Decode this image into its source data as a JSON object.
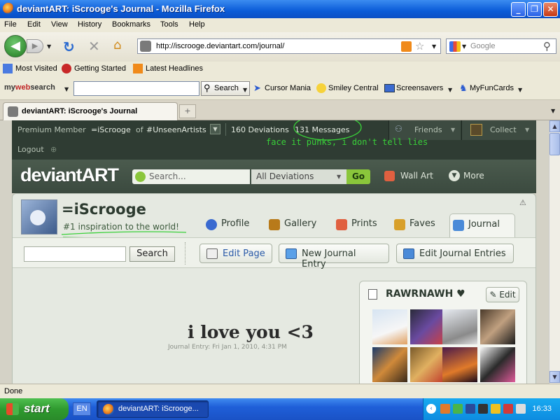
{
  "window": {
    "title": "deviantART: iScrooge's Journal - Mozilla Firefox",
    "buttons": [
      "_",
      "❐",
      "✕"
    ]
  },
  "menu": [
    "File",
    "Edit",
    "View",
    "History",
    "Bookmarks",
    "Tools",
    "Help"
  ],
  "nav": {
    "url": "http://iscrooge.deviantart.com/journal/",
    "search_placeholder": "Google"
  },
  "bookmarks": [
    "Most Visited",
    "Getting Started",
    "Latest Headlines"
  ],
  "mywebsearch": {
    "brand_prefix": "my",
    "brand_mid": "web",
    "brand_suffix": "search",
    "search_button": "Search",
    "items": [
      "Cursor Mania",
      "Smiley Central",
      "Screensavers",
      "MyFunCards"
    ]
  },
  "tab": {
    "label": "deviantART: iScrooge's Journal"
  },
  "da_top": {
    "member_label": "Premium Member",
    "member_name": "=iScrooge",
    "of": "of",
    "group": "#UnseenArtists",
    "deviations": "160 Deviations",
    "messages": "131 Messages",
    "friends": "Friends",
    "collect": "Collect",
    "logout": "Logout",
    "annotation": "face it punks, i don't tell lies"
  },
  "da_header": {
    "logo": "deviantART",
    "search_placeholder": "Search...",
    "category": "All Deviations",
    "go": "Go",
    "wall_art": "Wall Art",
    "more": "More"
  },
  "profile": {
    "username": "=iScrooge",
    "tagline": "#1 inspiration to the world!",
    "tabs": [
      "Profile",
      "Gallery",
      "Prints",
      "Faves",
      "Journal"
    ],
    "active_tab": "Journal",
    "search_button": "Search",
    "actions": [
      "Edit Page",
      "New Journal Entry",
      "Edit Journal Entries"
    ]
  },
  "journal": {
    "title": "i love you <3",
    "meta": "Journal Entry: Fri Jan 1, 2010, 4:31 PM"
  },
  "widget": {
    "title": "RAWRNAWH ♥",
    "edit": "Edit"
  },
  "status": "Done",
  "taskbar": {
    "start": "start",
    "lang": "EN",
    "task": "deviantART: iScrooge...",
    "clock": "16:33"
  },
  "colors": {
    "da_dark": "#2f3c33",
    "da_green": "#8ac63b",
    "annotation_green": "#39d039",
    "xp_blue": "#1f5fd8"
  }
}
